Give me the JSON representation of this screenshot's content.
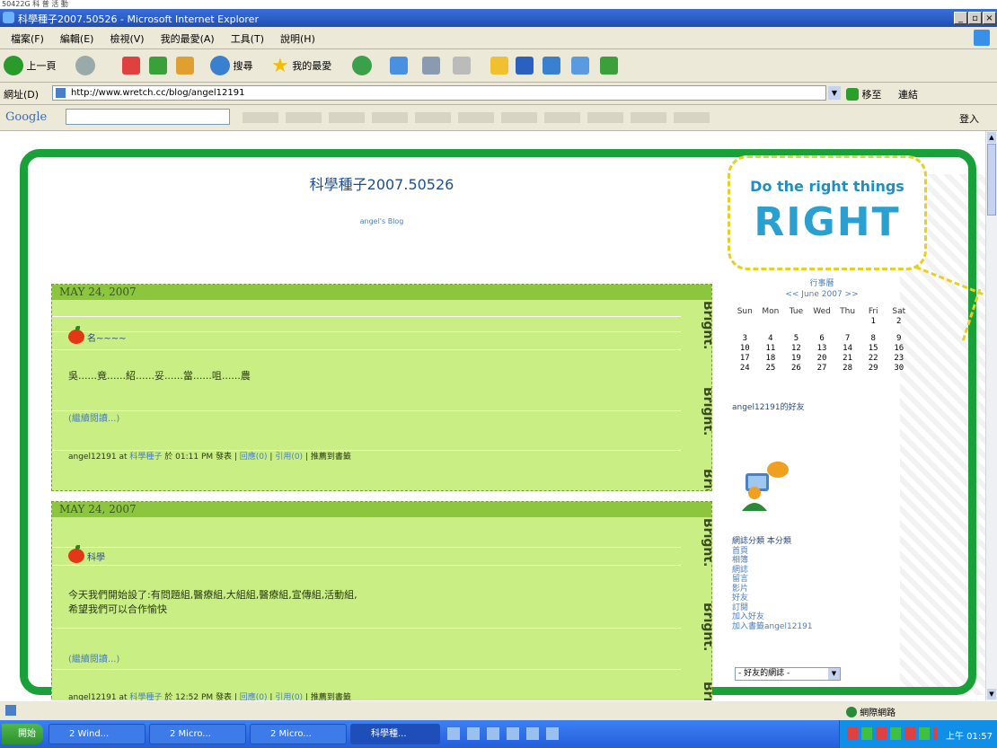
{
  "window": {
    "title": "科學種子2007.50526 - Microsoft Internet Explorer",
    "top_strip": "50422G  科 普 活 動"
  },
  "menu": [
    "檔案(F)",
    "編輯(E)",
    "檢視(V)",
    "我的最愛(A)",
    "工具(T)",
    "說明(H)"
  ],
  "toolbar": {
    "back": "上一頁",
    "search": "搜尋",
    "favorites": "我的最愛"
  },
  "address": {
    "label": "網址(D)",
    "url": "http://www.wretch.cc/blog/angel12191",
    "go": "移至",
    "links": "連結"
  },
  "google": {
    "logo": "Google",
    "signin": "登入"
  },
  "blog": {
    "title": "科學種子2007.50526",
    "subtitle": "angel's Blog",
    "bubble_line1": "Do the right things",
    "bubble_line2": "RIGHT",
    "posts": [
      {
        "date": "MAY 24, 2007",
        "title": "名~~~~",
        "body_lines": [
          "吳......竟......紹......妥......當......咀......農"
        ],
        "more": "(繼續閱讀...)",
        "author": "angel12191 at",
        "category": "科學種子",
        "time": "於 01:11 PM",
        "ops": "發表",
        "comments": "回應(0)",
        "trackback": "引用(0)",
        "recommend": "推薦到書籤",
        "bright": "Bright."
      },
      {
        "date": "MAY 24, 2007",
        "title": "科學",
        "body_lines": [
          "今天我們開始設了:有問題組,醫療組,大組組,醫療組,宣傳組,活動組,",
          "希望我們可以合作愉快"
        ],
        "more": "(繼續閱讀...)",
        "author": "angel12191 at",
        "category": "科學種子",
        "time": "於 12:52 PM",
        "ops": "發表",
        "comments": "回應(0)",
        "trackback": "引用(0)",
        "recommend": "推薦到書籤",
        "bright": "Bright."
      }
    ]
  },
  "calendar": {
    "label": "行事曆",
    "nav": "<< June 2007 >>",
    "days": [
      "Sun",
      "Mon",
      "Tue",
      "Wed",
      "Thu",
      "Fri",
      "Sat"
    ],
    "weeks": [
      [
        "",
        "",
        "",
        "",
        "",
        "1",
        "2"
      ],
      [
        "3",
        "4",
        "5",
        "6",
        "7",
        "8",
        "9"
      ],
      [
        "10",
        "11",
        "12",
        "13",
        "14",
        "15",
        "16"
      ],
      [
        "17",
        "18",
        "19",
        "20",
        "21",
        "22",
        "23"
      ],
      [
        "24",
        "25",
        "26",
        "27",
        "28",
        "29",
        "30"
      ]
    ]
  },
  "sidebar": {
    "buddy": "angel12191的好友",
    "categories_label": "網誌分類  本分類",
    "links": [
      "首頁",
      "相簿",
      "網誌",
      "留言",
      "影片",
      "好友",
      "訂閱",
      "加入好友",
      "加入書籤angel12191"
    ],
    "select_value": "- 好友的網誌 -"
  },
  "status": {
    "internet": "網際網路"
  },
  "taskbar": {
    "start": "開始",
    "tasks": [
      "2 Wind...",
      "2 Micro...",
      "2 Micro...",
      "科學種..."
    ],
    "clock": "上午 01:57"
  }
}
